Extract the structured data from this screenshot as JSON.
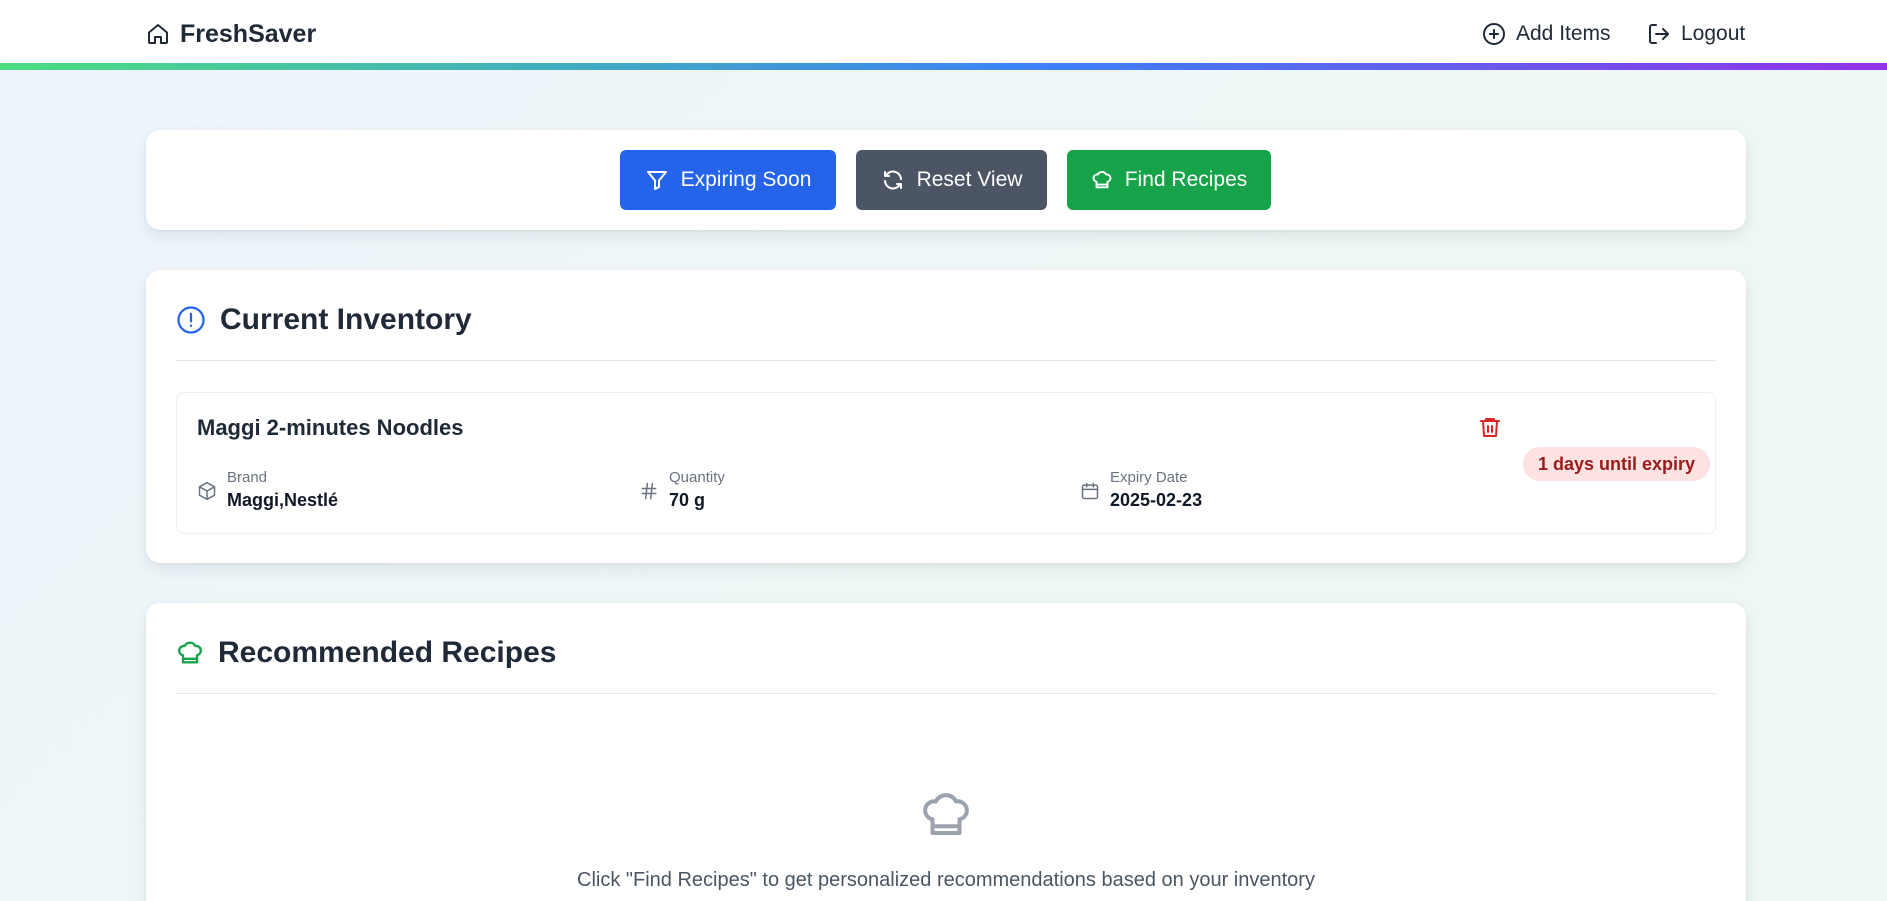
{
  "header": {
    "app_name": "FreshSaver",
    "nav": {
      "add_items": "Add Items",
      "logout": "Logout"
    }
  },
  "actions": {
    "expiring_soon": "Expiring Soon",
    "reset_view": "Reset View",
    "find_recipes": "Find Recipes"
  },
  "inventory": {
    "title": "Current Inventory",
    "items": [
      {
        "name": "Maggi 2-minutes Noodles",
        "brand_label": "Brand",
        "brand": "Maggi,Nestlé",
        "quantity_label": "Quantity",
        "quantity": "70 g",
        "expiry_label": "Expiry Date",
        "expiry_date": "2025-02-23",
        "expiry_badge": "1 days until expiry"
      }
    ]
  },
  "recipes": {
    "title": "Recommended Recipes",
    "empty_message": "Click \"Find Recipes\" to get personalized recommendations based on your inventory"
  },
  "icons": {
    "brand": "home-icon",
    "add_items": "plus-circle-icon",
    "logout": "logout-icon",
    "expiring_soon": "filter-icon",
    "reset_view": "refresh-icon",
    "find_recipes": "chef-hat-icon",
    "inventory_section": "alert-circle-icon",
    "recipes_section": "chef-hat-icon",
    "delete": "trash-icon",
    "brand_field": "package-icon",
    "quantity_field": "hash-icon",
    "expiry_field": "calendar-icon",
    "empty_recipes": "chef-hat-icon"
  },
  "colors": {
    "primary_blue": "#2563eb",
    "neutral_gray": "#4b5563",
    "success_green": "#16a34a",
    "danger_red": "#dc2626",
    "badge_bg": "#fde2e2",
    "badge_text": "#991b1b"
  }
}
